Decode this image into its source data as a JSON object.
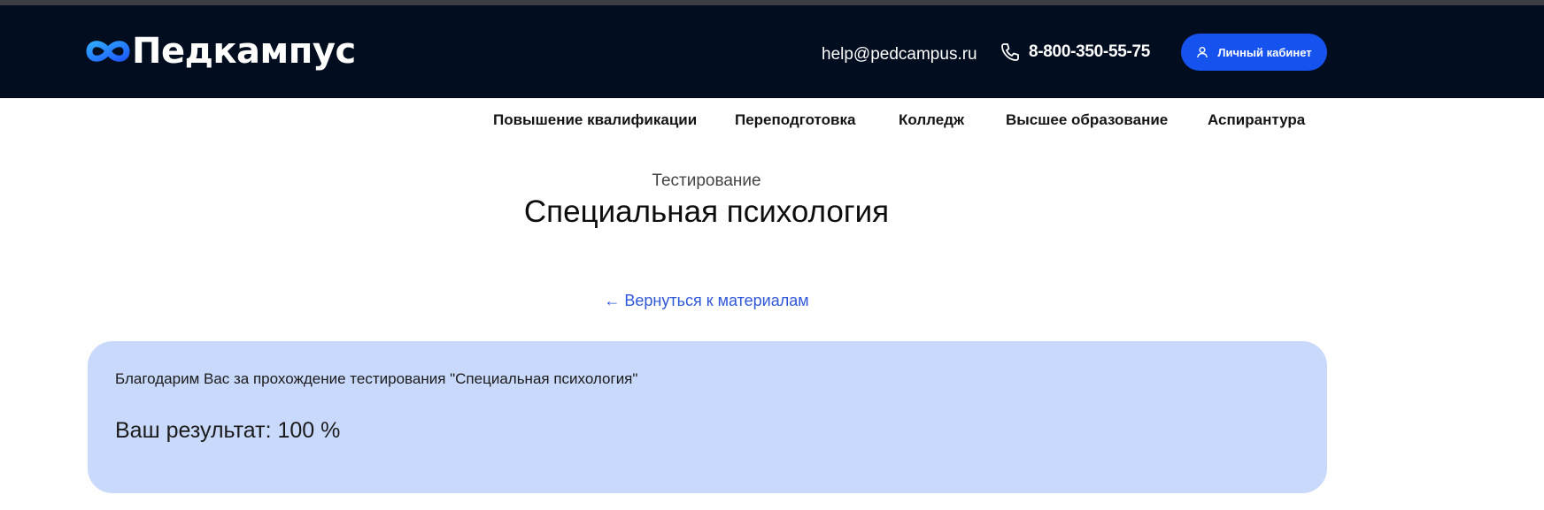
{
  "header": {
    "logo_text": "Педкампус",
    "email": "help@pedcampus.ru",
    "phone": "8-800-350-55-75",
    "cabinet_label": "Личный кабинет"
  },
  "nav": {
    "items": [
      {
        "label": "Повышение квалификации"
      },
      {
        "label": "Переподготовка"
      },
      {
        "label": "Колледж"
      },
      {
        "label": "Высшее образование"
      },
      {
        "label": "Аспирантура"
      }
    ]
  },
  "main": {
    "subtitle": "Тестирование",
    "title": "Специальная психология",
    "back_link": "← Вернуться к материалам",
    "thanks_text": "Благодарим Вас за прохождение тестирования \"Специальная психология\"",
    "result_text": "Ваш результат: 100 %"
  },
  "colors": {
    "header_bg": "#020d1f",
    "accent": "#1552ee",
    "card_bg": "#c8d9fb",
    "link": "#2f57d9"
  },
  "icons": [
    "infinity-logo-icon",
    "phone-icon",
    "user-icon"
  ]
}
